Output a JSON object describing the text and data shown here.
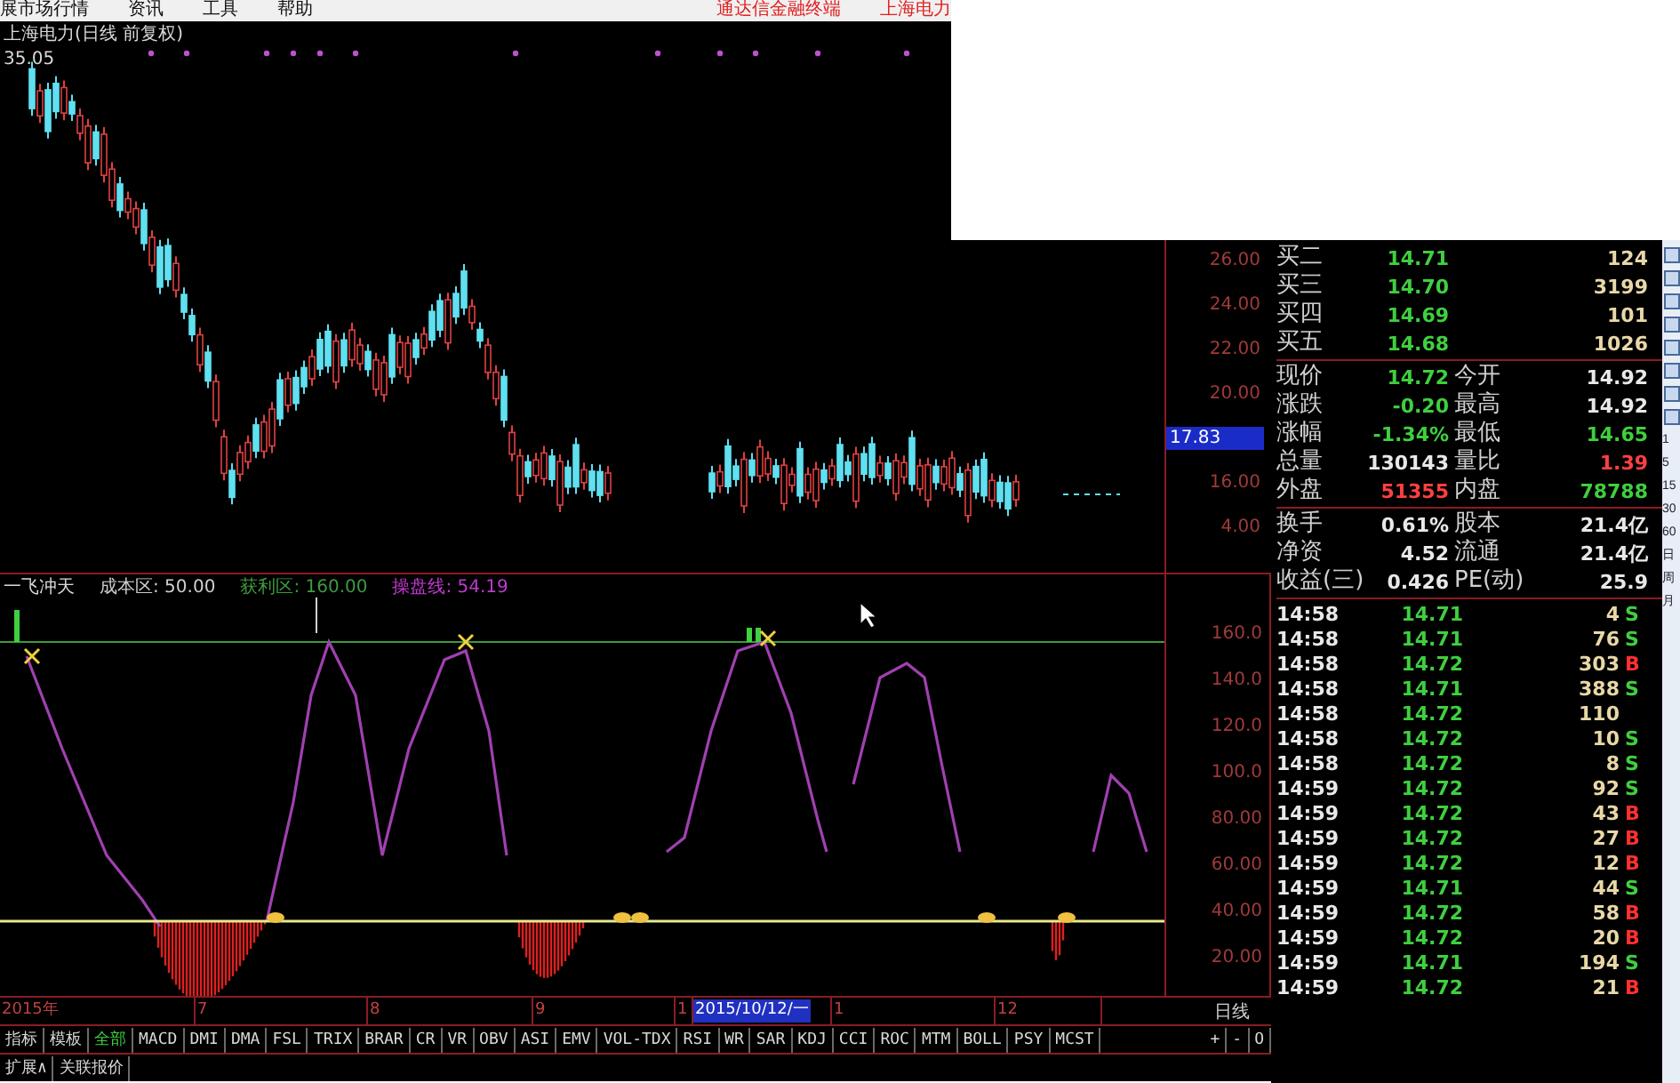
{
  "menu_bar": {
    "items": [
      "展市场行情",
      "资讯",
      "工具",
      "帮助"
    ],
    "right_items": [
      "通达信金融终端",
      "上海电力"
    ]
  },
  "price_chart": {
    "title": "上海电力(日线 前复权)",
    "high_label": "35.05",
    "axis_labels": [
      {
        "text": "26.00",
        "selected": false
      },
      {
        "text": "24.00",
        "selected": false
      },
      {
        "text": "22.00",
        "selected": false
      },
      {
        "text": "20.00",
        "selected": false
      },
      {
        "text": "17.83",
        "selected": true
      },
      {
        "text": "16.00",
        "selected": false
      },
      {
        "text": "4.00",
        "selected": false
      }
    ]
  },
  "indicator": {
    "name": "一飞冲天",
    "legend": [
      {
        "text": "成本区: 50.00",
        "kind": "cost"
      },
      {
        "text": "获利区: 160.00",
        "kind": "profit"
      },
      {
        "text": "操盘线: 54.19",
        "kind": "trade"
      }
    ],
    "axis_labels": [
      "160.0",
      "140.0",
      "120.0",
      "100.0",
      "80.00",
      "60.00",
      "40.00",
      "20.00"
    ]
  },
  "date_axis": {
    "labels": [
      {
        "text": "2015年",
        "selected": false
      },
      {
        "text": "7",
        "selected": false
      },
      {
        "text": "8",
        "selected": false
      },
      {
        "text": "9",
        "selected": false
      },
      {
        "text": "1",
        "selected": false
      },
      {
        "text": "2015/10/12/一",
        "selected": true
      },
      {
        "text": "1",
        "selected": false
      },
      {
        "text": "12",
        "selected": false
      }
    ],
    "period": "日线"
  },
  "indicator_tabs": {
    "leading": [
      {
        "label": "指标",
        "selected": false
      },
      {
        "label": "模板",
        "selected": false
      },
      {
        "label": "全部",
        "selected": true
      }
    ],
    "tabs": [
      "MACD",
      "DMI",
      "DMA",
      "FSL",
      "TRIX",
      "BRAR",
      "CR",
      "VR",
      "OBV",
      "ASI",
      "EMV",
      "VOL-TDX",
      "RSI",
      "WR",
      "SAR",
      "KDJ",
      "CCI",
      "ROC",
      "MTM",
      "BOLL",
      "PSY",
      "MCST"
    ],
    "controls": [
      "+",
      "-",
      "O"
    ]
  },
  "bottom_tabs": [
    "扩展∧",
    "关联报价"
  ],
  "quote": {
    "bids": [
      {
        "label": "买二",
        "price": "14.71",
        "volume": "124"
      },
      {
        "label": "买三",
        "price": "14.70",
        "volume": "3199"
      },
      {
        "label": "买四",
        "price": "14.69",
        "volume": "101"
      },
      {
        "label": "买五",
        "price": "14.68",
        "volume": "1026"
      }
    ],
    "stats": [
      [
        {
          "label": "现价",
          "value": "14.72",
          "kind": "down"
        },
        {
          "label": "今开",
          "value": "14.92",
          "kind": "flat"
        }
      ],
      [
        {
          "label": "涨跌",
          "value": "-0.20",
          "kind": "down"
        },
        {
          "label": "最高",
          "value": "14.92",
          "kind": "flat"
        }
      ],
      [
        {
          "label": "涨幅",
          "value": "-1.34%",
          "kind": "down"
        },
        {
          "label": "最低",
          "value": "14.65",
          "kind": "down"
        }
      ],
      [
        {
          "label": "总量",
          "value": "130143",
          "kind": "flat"
        },
        {
          "label": "量比",
          "value": "1.39",
          "kind": "up"
        }
      ],
      [
        {
          "label": "外盘",
          "value": "51355",
          "kind": "up"
        },
        {
          "label": "内盘",
          "value": "78788",
          "kind": "down"
        }
      ]
    ],
    "fundamentals": [
      [
        {
          "label": "换手",
          "value": "0.61%"
        },
        {
          "label": "股本",
          "value": "21.4亿"
        }
      ],
      [
        {
          "label": "净资",
          "value": "4.52"
        },
        {
          "label": "流通",
          "value": "21.4亿"
        }
      ],
      [
        {
          "label": "收益(三)",
          "value": "0.426"
        },
        {
          "label": "PE(动)",
          "value": "25.9"
        }
      ]
    ],
    "ticks": [
      {
        "time": "14:58",
        "price": "14.71",
        "volume": "4",
        "side": "S",
        "kind": "sell"
      },
      {
        "time": "14:58",
        "price": "14.71",
        "volume": "76",
        "side": "S",
        "kind": "sell"
      },
      {
        "time": "14:58",
        "price": "14.72",
        "volume": "303",
        "side": "B",
        "kind": "buy"
      },
      {
        "time": "14:58",
        "price": "14.71",
        "volume": "388",
        "side": "S",
        "kind": "sell"
      },
      {
        "time": "14:58",
        "price": "14.72",
        "volume": "110",
        "kind": "none"
      },
      {
        "time": "14:58",
        "price": "14.72",
        "volume": "10",
        "side": "S",
        "kind": "sell"
      },
      {
        "time": "14:58",
        "price": "14.72",
        "volume": "8",
        "side": "S",
        "kind": "sell"
      },
      {
        "time": "14:59",
        "price": "14.72",
        "volume": "92",
        "side": "S",
        "kind": "sell"
      },
      {
        "time": "14:59",
        "price": "14.72",
        "volume": "43",
        "side": "B",
        "kind": "buy"
      },
      {
        "time": "14:59",
        "price": "14.72",
        "volume": "27",
        "side": "B",
        "kind": "buy"
      },
      {
        "time": "14:59",
        "price": "14.72",
        "volume": "12",
        "side": "B",
        "kind": "buy"
      },
      {
        "time": "14:59",
        "price": "14.71",
        "volume": "44",
        "side": "S",
        "kind": "sell"
      },
      {
        "time": "14:59",
        "price": "14.72",
        "volume": "58",
        "side": "B",
        "kind": "buy"
      },
      {
        "time": "14:59",
        "price": "14.72",
        "volume": "20",
        "side": "B",
        "kind": "buy"
      },
      {
        "time": "14:59",
        "price": "14.71",
        "volume": "194",
        "side": "S",
        "kind": "sell"
      },
      {
        "time": "14:59",
        "price": "14.72",
        "volume": "21",
        "side": "B",
        "kind": "buy"
      }
    ]
  },
  "period_strip": [
    "1",
    "5",
    "15",
    "30",
    "60",
    "日",
    "周",
    "月"
  ]
}
